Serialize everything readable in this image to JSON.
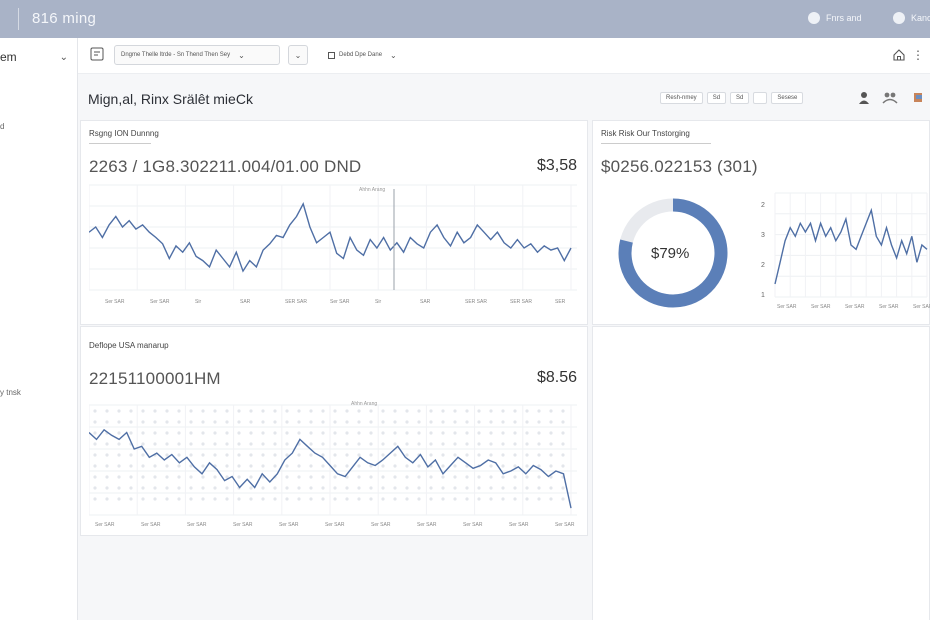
{
  "topbar": {
    "title": "816 ming",
    "user1": "Fnrs and",
    "user2": "Kanosa"
  },
  "sidebar": {
    "select": "em",
    "item1": "d",
    "item2": "y tnsk"
  },
  "toolbar": {
    "dropdown1": "Dngme Thelle ltrde - Sn Thend Then Sey",
    "dropdown2": "Debd Dpe Dane"
  },
  "page": {
    "title": "Mign,al, Rinx Srälêt mieCk"
  },
  "right_tools": {
    "pill1": "Resh-nmey",
    "pill2": "Sd",
    "pill3": "Sd",
    "pill4": "Sesese"
  },
  "panel_a": {
    "title": "Rsgng ION Dunnng",
    "big_number": "2263 / 1G8.302211.004/01.00 DND",
    "value": "$3,58",
    "chart_label": "Ahhn Arang",
    "x_labels": [
      "Ser SAR",
      "Ser SAR",
      "Sir",
      "SAR",
      "SER SAR",
      "Ser SAR",
      "Sir",
      "SAR",
      "SER SAR",
      "SER SAR",
      "SER"
    ]
  },
  "panel_b": {
    "title": "Risk Risk Our Tnstorging",
    "big_number": "$0256.022153 (301)",
    "donut_label": "$79%",
    "donut_fraction": 0.79,
    "y_ticks": [
      "2",
      "3",
      "2",
      "1"
    ]
  },
  "panel_c": {
    "title": "Deflope USA manarup",
    "big_number": "22151100001HM",
    "value": "$8.56",
    "chart_label": "Ahhn Arang"
  },
  "colors": {
    "topbar": "#a9b3c7",
    "accent": "#5b7fb8",
    "line": "#4f6fa5"
  },
  "chart_data": [
    {
      "type": "line",
      "title": "Rsgng ION Dunnng",
      "series": [
        {
          "values": [
            0.55,
            0.6,
            0.5,
            0.62,
            0.7,
            0.6,
            0.66,
            0.58,
            0.62,
            0.55,
            0.5,
            0.44,
            0.3,
            0.42,
            0.36,
            0.45,
            0.32,
            0.28,
            0.22,
            0.38,
            0.3,
            0.22,
            0.36,
            0.18,
            0.28,
            0.22,
            0.38,
            0.44,
            0.52,
            0.5,
            0.62,
            0.7,
            0.82,
            0.6,
            0.45,
            0.5,
            0.55,
            0.35,
            0.3,
            0.5,
            0.38,
            0.33,
            0.48,
            0.4,
            0.5,
            0.38,
            0.45,
            0.36,
            0.5,
            0.44,
            0.4,
            0.55,
            0.62,
            0.5,
            0.42,
            0.55,
            0.45,
            0.5,
            0.62,
            0.55,
            0.48,
            0.55,
            0.45,
            0.4,
            0.48,
            0.4,
            0.44,
            0.36,
            0.42,
            0.38,
            0.4,
            0.28,
            0.4
          ]
        }
      ]
    },
    {
      "type": "line",
      "title": "Risk Risk Our Tnstorging",
      "series": [
        {
          "values": [
            1.1,
            1.6,
            2.1,
            2.4,
            2.2,
            2.5,
            2.3,
            2.5,
            2.1,
            2.5,
            2.2,
            2.4,
            2.1,
            2.3,
            2.6,
            2.0,
            1.9,
            2.2,
            2.5,
            2.8,
            2.2,
            2.0,
            2.4,
            2.0,
            1.7,
            2.1,
            1.8,
            2.2,
            1.6,
            2.0,
            1.9
          ]
        }
      ]
    },
    {
      "type": "line",
      "title": "Deflope USA manarup",
      "series": [
        {
          "values": [
            0.6,
            0.55,
            0.62,
            0.58,
            0.55,
            0.6,
            0.48,
            0.5,
            0.42,
            0.45,
            0.4,
            0.44,
            0.38,
            0.42,
            0.35,
            0.3,
            0.38,
            0.33,
            0.25,
            0.28,
            0.2,
            0.26,
            0.2,
            0.3,
            0.24,
            0.3,
            0.4,
            0.45,
            0.55,
            0.5,
            0.45,
            0.42,
            0.36,
            0.3,
            0.28,
            0.35,
            0.42,
            0.38,
            0.36,
            0.4,
            0.45,
            0.5,
            0.42,
            0.38,
            0.44,
            0.35,
            0.4,
            0.3,
            0.36,
            0.42,
            0.38,
            0.34,
            0.36,
            0.4,
            0.38,
            0.3,
            0.32,
            0.35,
            0.3,
            0.36,
            0.33,
            0.28,
            0.32,
            0.3,
            0.05
          ]
        }
      ]
    }
  ]
}
